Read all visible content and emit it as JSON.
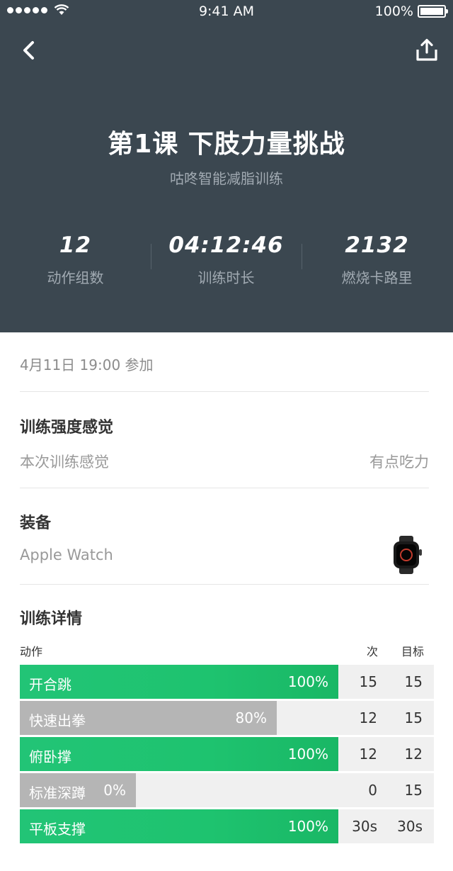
{
  "status_bar": {
    "time": "9:41 AM",
    "battery": "100%"
  },
  "header": {
    "title": "第1课 下肢力量挑战",
    "subtitle": "咕咚智能减脂训练",
    "stats": [
      {
        "value": "12",
        "label": "动作组数"
      },
      {
        "value": "04:12:46",
        "label": "训练时长"
      },
      {
        "value": "2132",
        "label": "燃烧卡路里"
      }
    ]
  },
  "record": {
    "date_line": "4月11日 19:00 参加"
  },
  "intensity": {
    "title": "训练强度感觉",
    "label": "本次训练感觉",
    "value": "有点吃力"
  },
  "equipment": {
    "title": "装备",
    "device": "Apple Watch",
    "icon": "apple-watch-icon"
  },
  "details": {
    "title": "训练详情",
    "headers": {
      "action": "动作",
      "count": "次",
      "target": "目标"
    },
    "exercises": [
      {
        "name": "开合跳",
        "percent_label": "100%",
        "progress": 0.77,
        "count": "15",
        "target": "15",
        "status": "complete"
      },
      {
        "name": "快速出拳",
        "percent_label": "80%",
        "progress": 0.62,
        "count": "12",
        "target": "15",
        "status": "partial"
      },
      {
        "name": "俯卧撑",
        "percent_label": "100%",
        "progress": 0.77,
        "count": "12",
        "target": "12",
        "status": "complete"
      },
      {
        "name": "标准深蹲",
        "percent_label": "0%",
        "progress": 0.28,
        "count": "0",
        "target": "15",
        "status": "partial"
      },
      {
        "name": "平板支撑",
        "percent_label": "100%",
        "progress": 0.77,
        "count": "30s",
        "target": "30s",
        "status": "complete"
      }
    ]
  },
  "colors": {
    "header_bg": "#3b4750",
    "complete": "#1ec36f",
    "partial": "#b5b5b5",
    "track": "#f0f0f0"
  }
}
